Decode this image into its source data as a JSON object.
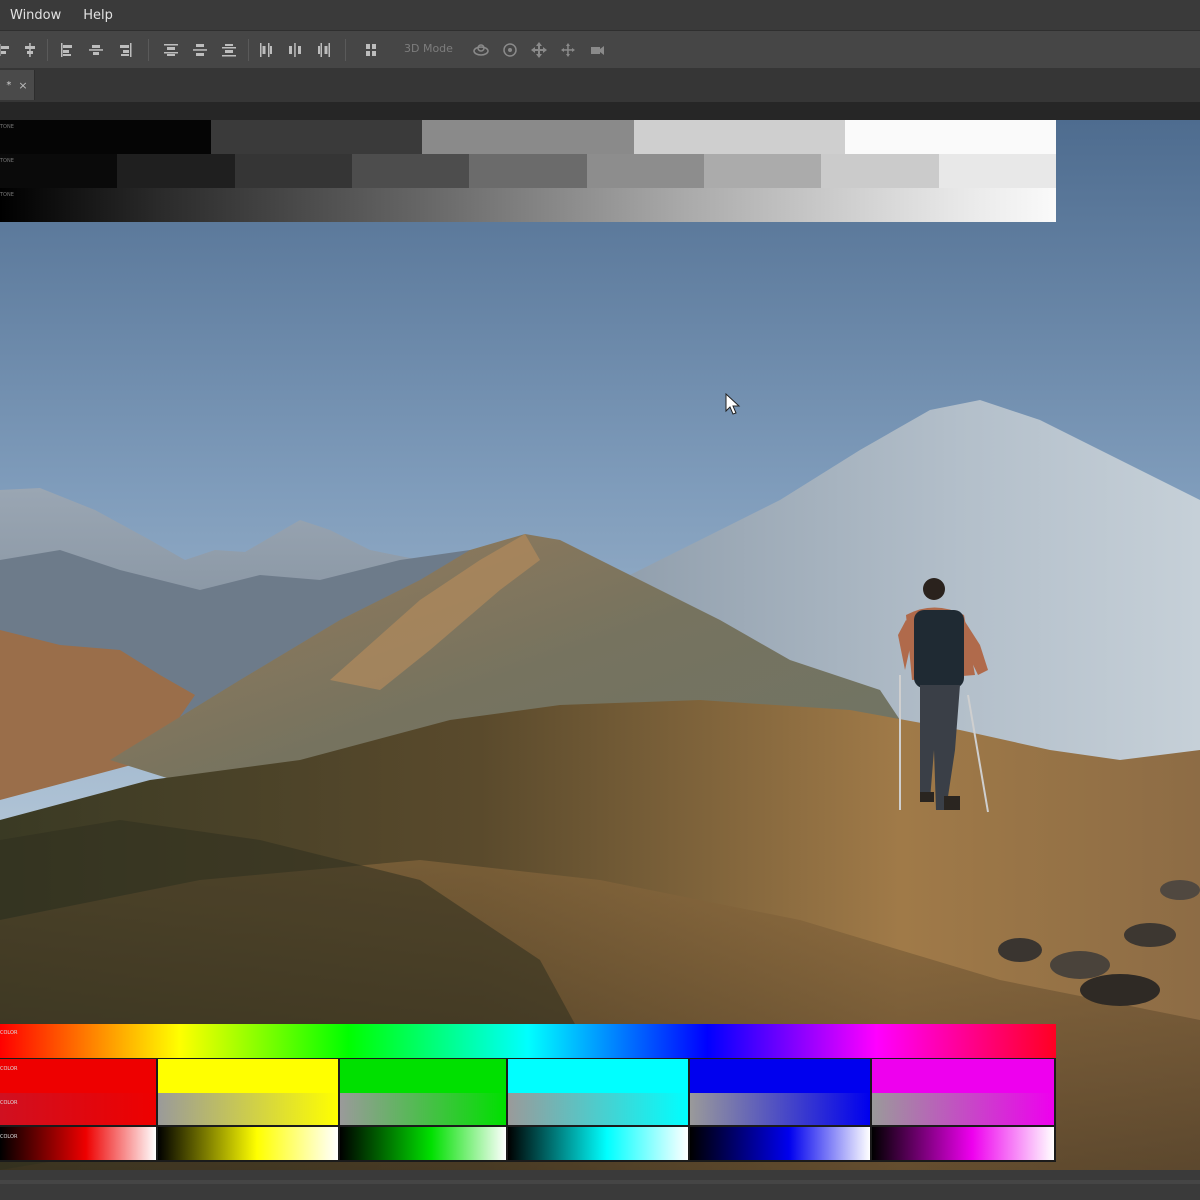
{
  "menubar": {
    "items": [
      "Window",
      "Help"
    ]
  },
  "optionsbar": {
    "mode_3d_label": "3D Mode",
    "tool_icons": [
      "align-left-edges-icon",
      "align-horizontal-centers-icon",
      "align-right-edges-icon",
      "align-top-edges-icon",
      "align-vertical-centers-icon",
      "align-bottom-edges-icon",
      "distribute-top-icon",
      "distribute-vertical-centers-icon",
      "distribute-bottom-icon",
      "distribute-left-icon",
      "distribute-horizontal-centers-icon",
      "distribute-right-icon",
      "auto-align-icon",
      "orbit-3d-icon",
      "roll-3d-icon",
      "pan-3d-icon",
      "slide-3d-icon",
      "scale-3d-icon"
    ]
  },
  "document_tab": {
    "modified_marker": "*",
    "close_glyph": "×"
  },
  "test_patterns": {
    "gray_label_text": "TONE",
    "color_label_text": "COLOR",
    "gray_row1_colors": [
      "#050505",
      "#3a3a3a",
      "#8a8a8a",
      "#cfcfcf",
      "#fafafa"
    ],
    "gray_row2_colors": [
      "#0a0a0a",
      "#1f1f1f",
      "#353535",
      "#4d4d4d",
      "#6b6b6b",
      "#8d8d8d",
      "#ababab",
      "#cbcbcb",
      "#e8e8e8"
    ],
    "color_primaries": [
      "#ee0000",
      "#ffff00",
      "#00e000",
      "#00ffff",
      "#0000ee",
      "#ee00ee"
    ],
    "color_desaturated": [
      "#d01020",
      "#9a9a9a",
      "#9a9a9a",
      "#9a9a9a",
      "#9a9a9a",
      "#9a9a9a"
    ]
  },
  "colors": {
    "menubar": "#3a3a3a",
    "optionsbar": "#464646",
    "canvas": "#262626"
  }
}
